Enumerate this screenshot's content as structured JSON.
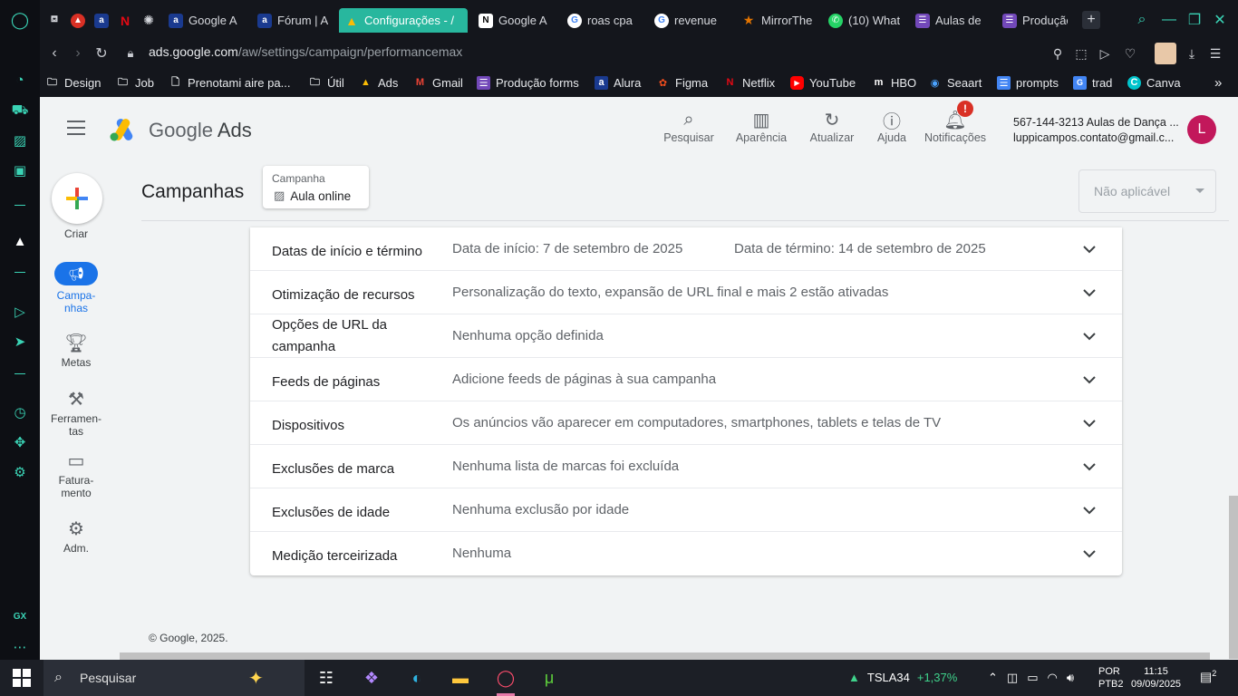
{
  "browser": {
    "tabs": [
      {
        "label": "",
        "fav": "tab-favicon-game",
        "color": "#888"
      },
      {
        "label": "",
        "fav": "tab-favicon-app",
        "color": "#d93025"
      },
      {
        "label": "",
        "fav": "tab-favicon-alura",
        "color": "#1a3a8f"
      },
      {
        "label": "",
        "fav": "tab-favicon-netflix",
        "color": "#e50914"
      },
      {
        "label": "",
        "fav": "tab-favicon-chatgpt",
        "color": "#444"
      },
      {
        "label": "Google A",
        "fav": "tab-favicon-alura",
        "color": "#1a3a8f"
      },
      {
        "label": "Fórum | A",
        "fav": "tab-favicon-alura",
        "color": "#1a3a8f"
      },
      {
        "label": "Configurações - /",
        "fav": "tab-favicon-ads",
        "color": "#fbbc04"
      },
      {
        "label": "Google A",
        "fav": "tab-favicon-notion",
        "color": "#222"
      },
      {
        "label": "roas cpa",
        "fav": "tab-favicon-google",
        "color": "#fff"
      },
      {
        "label": "revenue",
        "fav": "tab-favicon-google",
        "color": "#fff"
      },
      {
        "label": "MirrorThe",
        "fav": "tab-favicon-star",
        "color": "#e37400"
      },
      {
        "label": "(10) What",
        "fav": "tab-favicon-whatsapp",
        "color": "#25d366"
      },
      {
        "label": "Aulas de",
        "fav": "tab-favicon-forms",
        "color": "#7248b9"
      },
      {
        "label": "Produção",
        "fav": "tab-favicon-forms",
        "color": "#7248b9"
      }
    ],
    "url_prefix": "ads.google.com",
    "url_path": "/aw/settings/campaign/performancemax",
    "bookmarks": [
      {
        "label": "Design",
        "icon": "folder-icon"
      },
      {
        "label": "Job",
        "icon": "folder-icon"
      },
      {
        "label": "Prenotami aire pa...",
        "icon": "page-icon"
      },
      {
        "label": "Útil",
        "icon": "folder-icon"
      },
      {
        "label": "Ads",
        "icon": "ads-icon"
      },
      {
        "label": "Gmail",
        "icon": "gmail-icon"
      },
      {
        "label": "Produção forms",
        "icon": "forms-icon"
      },
      {
        "label": "Alura",
        "icon": "alura-icon"
      },
      {
        "label": "Figma",
        "icon": "figma-icon"
      },
      {
        "label": "Netflix",
        "icon": "netflix-icon"
      },
      {
        "label": "YouTube",
        "icon": "youtube-icon"
      },
      {
        "label": "HBO",
        "icon": "hbo-icon"
      },
      {
        "label": "Seaart",
        "icon": "seaart-icon"
      },
      {
        "label": "prompts",
        "icon": "docs-icon"
      },
      {
        "label": "trad",
        "icon": "translate-icon"
      },
      {
        "label": "Canva",
        "icon": "canva-icon"
      }
    ]
  },
  "ads": {
    "logo_google": "Google",
    "logo_ads": "Ads",
    "header_actions": [
      {
        "label": "Pesquisar",
        "icon": "search-icon"
      },
      {
        "label": "Aparência",
        "icon": "appearance-icon"
      },
      {
        "label": "Atualizar",
        "icon": "refresh-icon"
      },
      {
        "label": "Ajuda",
        "icon": "help-icon"
      },
      {
        "label": "Notificações",
        "icon": "bell-icon"
      }
    ],
    "notif_badge": "!",
    "account_line1": "567-144-3213 Aulas de Dança ...",
    "account_line2": "luppicampos.contato@gmail.c...",
    "avatar_letter": "L",
    "nav": [
      {
        "label": "Criar"
      },
      {
        "label": "Campa-\nnhas"
      },
      {
        "label": "Metas"
      },
      {
        "label": "Ferramen-\ntas"
      },
      {
        "label": "Fatura-\nmento"
      },
      {
        "label": "Adm."
      }
    ],
    "page_title": "Campanhas",
    "campaign_label": "Campanha",
    "campaign_name": "Aula online",
    "select_value": "Não aplicável",
    "settings": [
      {
        "name": "Datas de início e término",
        "value": "Data de início: 7 de setembro de 2025",
        "value2": "Data de término: 14 de setembro de 2025"
      },
      {
        "name": "Otimização de recursos",
        "value": "Personalização do texto, expansão de URL final e mais 2 estão ativadas"
      },
      {
        "name": "Opções de URL da campanha",
        "value": "Nenhuma opção definida"
      },
      {
        "name": "Feeds de páginas",
        "value": "Adicione feeds de páginas à sua campanha"
      },
      {
        "name": "Dispositivos",
        "value": "Os anúncios vão aparecer em computadores, smartphones, tablets e telas de TV"
      },
      {
        "name": "Exclusões de marca",
        "value": "Nenhuma lista de marcas foi excluída"
      },
      {
        "name": "Exclusões de idade",
        "value": "Nenhuma exclusão por idade"
      },
      {
        "name": "Medição terceirizada",
        "value": "Nenhuma"
      }
    ],
    "footer": "© Google, 2025."
  },
  "taskbar": {
    "search_placeholder": "Pesquisar",
    "stock_symbol": "TSLA34",
    "stock_change": "+1,37%",
    "lang_1": "POR",
    "lang_2": "PTB2",
    "time": "11:15",
    "date": "09/09/2025",
    "notif_count": "2"
  },
  "colors": {
    "accent": "#28b79e",
    "gx": "#3ad3b5",
    "ads_blue": "#1a73e8"
  }
}
